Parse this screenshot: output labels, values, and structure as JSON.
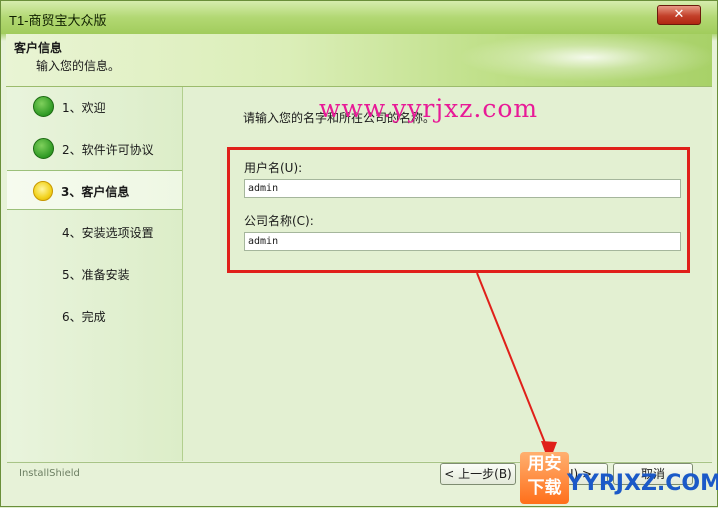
{
  "window": {
    "title": "T1-商贸宝大众版",
    "close_label": "✕"
  },
  "header": {
    "title": "客户信息",
    "subtitle": "输入您的信息。"
  },
  "steps": [
    {
      "label": "1、欢迎",
      "status": "done"
    },
    {
      "label": "2、软件许可协议",
      "status": "done"
    },
    {
      "label": "3、客户信息",
      "status": "current"
    },
    {
      "label": "4、安装选项设置",
      "status": "pending"
    },
    {
      "label": "5、准备安装",
      "status": "pending"
    },
    {
      "label": "6、完成",
      "status": "pending"
    }
  ],
  "content": {
    "intro": "请输入您的名字和所在公司的名称。",
    "username_label": "用户名(U):",
    "username_value": "admin",
    "company_label": "公司名称(C):",
    "company_value": "admin"
  },
  "footer": {
    "brand": "InstallShield",
    "back_label": "< 上一步(B)",
    "next_label": "(N) >",
    "cancel_label": "取消"
  },
  "watermark": {
    "url": "www.yyrjxz.com",
    "logo_top": "用安",
    "logo_bottom": "下载",
    "logo_text": "YYRJXZ.COM"
  },
  "colors": {
    "accent": "#e0201a",
    "watermark": "#e81a97"
  }
}
